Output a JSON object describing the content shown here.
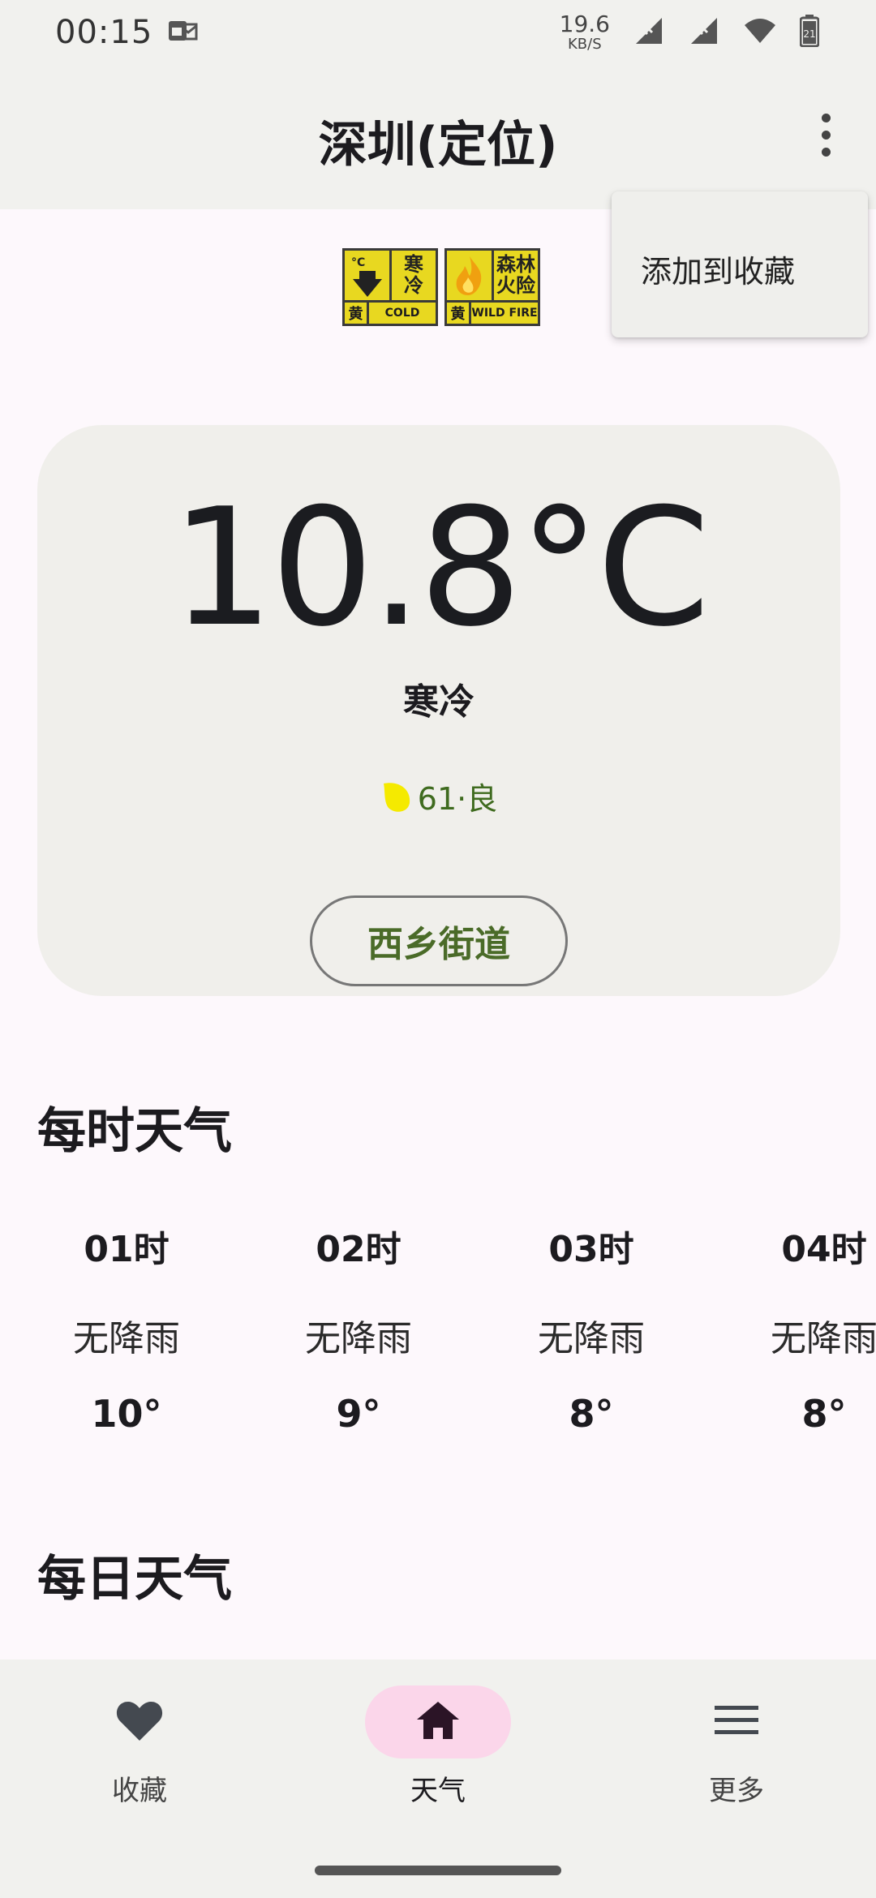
{
  "status_bar": {
    "time": "00:15",
    "speed_value": "19.6",
    "speed_unit": "KB/S",
    "battery_level": "21"
  },
  "app_bar": {
    "title": "深圳(定位)",
    "more_icon": "more-vertical-icon"
  },
  "menu": {
    "items": [
      {
        "label": "添加到收藏"
      }
    ]
  },
  "warnings": [
    {
      "icon": "thermometer-icon",
      "chars": [
        "寒",
        "冷"
      ],
      "level": "黄",
      "en": "COLD",
      "color": "#e8d820"
    },
    {
      "icon": "fire-icon",
      "chars": [
        "森林",
        "火险"
      ],
      "level": "黄",
      "en": "WILD FIRE",
      "color": "#e8d820"
    }
  ],
  "current": {
    "temperature": "10.8°C",
    "condition": "寒冷",
    "aqi_text": "61·良",
    "aqi_color": "#f5ea00",
    "district": "西乡街道"
  },
  "hourly": {
    "title": "每时天气",
    "items": [
      {
        "time": "01时",
        "desc": "无降雨",
        "temp": "10°"
      },
      {
        "time": "02时",
        "desc": "无降雨",
        "temp": "9°"
      },
      {
        "time": "03时",
        "desc": "无降雨",
        "temp": "8°"
      },
      {
        "time": "04时",
        "desc": "无降雨",
        "temp": "8°"
      }
    ]
  },
  "daily": {
    "title": "每日天气"
  },
  "bottom_nav": {
    "items": [
      {
        "label": "收藏",
        "icon": "heart-icon",
        "active": false
      },
      {
        "label": "天气",
        "icon": "home-icon",
        "active": true
      },
      {
        "label": "更多",
        "icon": "menu-icon",
        "active": false
      }
    ]
  }
}
